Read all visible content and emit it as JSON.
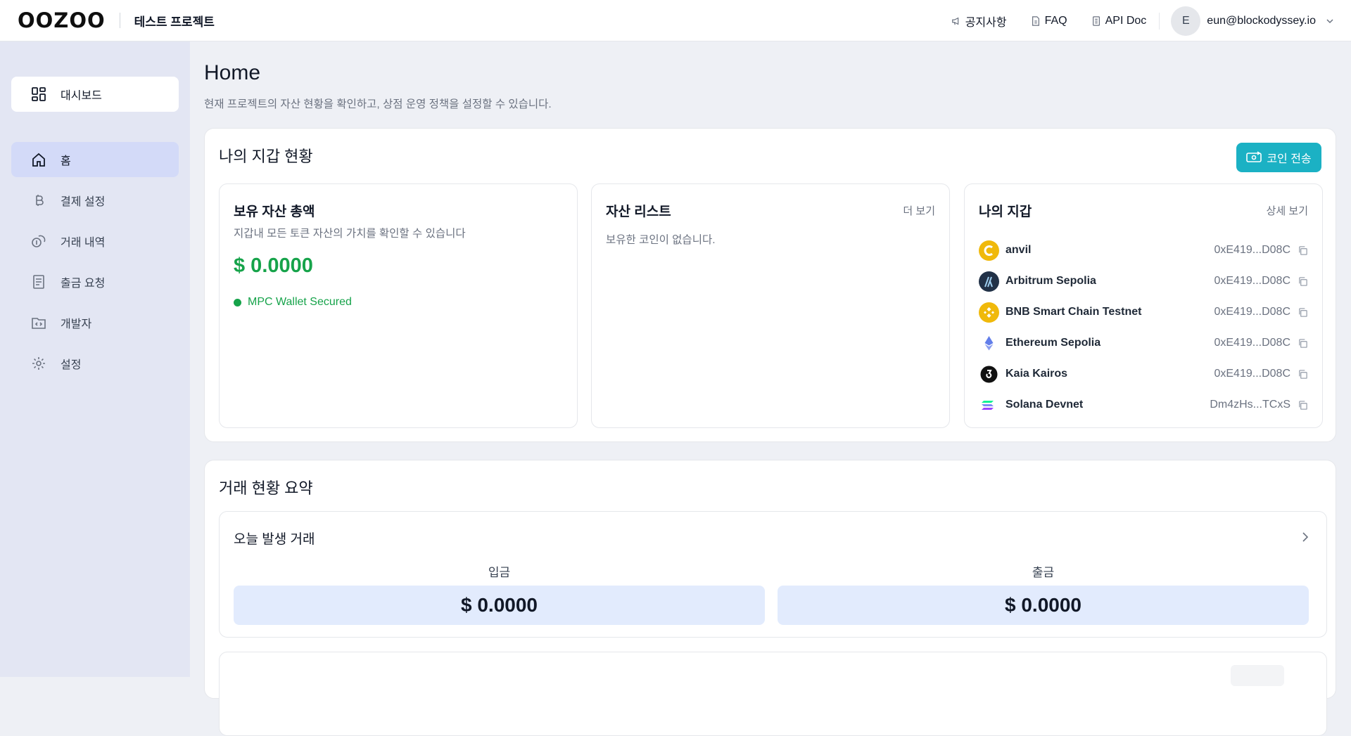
{
  "header": {
    "logo": "OOZOO",
    "project": "테스트 프로젝트",
    "links": [
      {
        "label": "공지사항",
        "icon": "megaphone-icon"
      },
      {
        "label": "FAQ",
        "icon": "document-icon"
      },
      {
        "label": "API Doc",
        "icon": "api-doc-icon"
      }
    ],
    "user": {
      "initial": "E",
      "email": "eun@blockodyssey.io"
    }
  },
  "sidebar": {
    "dashboard": "대시보드",
    "items": [
      {
        "label": "홈",
        "icon": "home-icon",
        "active": true
      },
      {
        "label": "결제 설정",
        "icon": "bitcoin-icon"
      },
      {
        "label": "거래 내역",
        "icon": "coins-icon"
      },
      {
        "label": "출금 요청",
        "icon": "receipt-icon"
      },
      {
        "label": "개발자",
        "icon": "code-folder-icon"
      },
      {
        "label": "설정",
        "icon": "gear-icon"
      }
    ]
  },
  "page": {
    "title": "Home",
    "subtitle": "현재 프로젝트의 자산 현황을 확인하고, 상점 운영 정책을 설정할 수 있습니다."
  },
  "wallet_status": {
    "title": "나의 지갑 현황",
    "send_button": "코인 전송",
    "total": {
      "title": "보유 자산 총액",
      "desc": "지갑내 모든 토큰 자산의 가치를 확인할 수 있습니다",
      "amount": "$ 0.0000",
      "secured": "MPC Wallet Secured"
    },
    "assets": {
      "title": "자산 리스트",
      "more": "더 보기",
      "empty": "보유한 코인이 없습니다."
    },
    "wallets": {
      "title": "나의 지갑",
      "more": "상세 보기",
      "items": [
        {
          "name": "anvil",
          "address": "0xE419...D08C",
          "color": "#f0b90b"
        },
        {
          "name": "Arbitrum Sepolia",
          "address": "0xE419...D08C",
          "color": "#213147"
        },
        {
          "name": "BNB Smart Chain Testnet",
          "address": "0xE419...D08C",
          "color": "#f0b90b"
        },
        {
          "name": "Ethereum Sepolia",
          "address": "0xE419...D08C",
          "color": "#627eea"
        },
        {
          "name": "Kaia Kairos",
          "address": "0xE419...D08C",
          "color": "#111111"
        },
        {
          "name": "Solana Devnet",
          "address": "Dm4zHs...TCxS",
          "color": "#9945ff"
        }
      ]
    }
  },
  "tx_summary": {
    "title": "거래 현황 요약",
    "today": {
      "title": "오늘 발생 거래",
      "deposit_label": "입금",
      "deposit_amount": "$ 0.0000",
      "withdraw_label": "출금",
      "withdraw_amount": "$ 0.0000"
    }
  },
  "colors": {
    "accent": "#1bb1c4",
    "success": "#16a34a",
    "sidebar_bg": "#e3e6f3",
    "active_nav": "#d3daf8",
    "amount_box": "#e2ebfd"
  }
}
